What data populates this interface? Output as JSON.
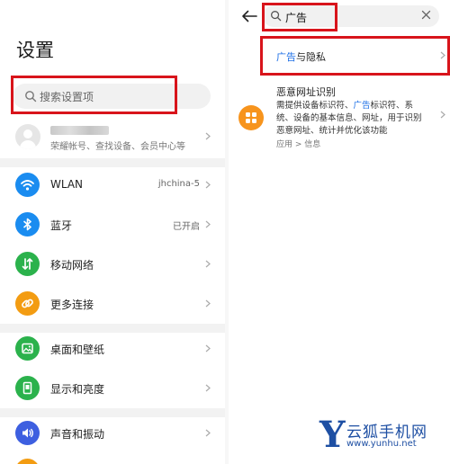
{
  "left": {
    "title": "设置",
    "search": {
      "placeholder": "搜索设置项"
    },
    "account": {
      "subtitle": "荣耀帐号、查找设备、会员中心等"
    },
    "items": [
      {
        "label": "WLAN",
        "value": "jhchina-5",
        "icon": "wifi-icon",
        "color": "#1a8cf0"
      },
      {
        "label": "蓝牙",
        "value": "已开启",
        "icon": "bluetooth-icon",
        "color": "#1a8cf0"
      },
      {
        "label": "移动网络",
        "value": "",
        "icon": "mobile-data-icon",
        "color": "#2bb24c"
      },
      {
        "label": "更多连接",
        "value": "",
        "icon": "link-icon",
        "color": "#f39c12"
      },
      {
        "label": "桌面和壁纸",
        "value": "",
        "icon": "image-icon",
        "color": "#2bb24c"
      },
      {
        "label": "显示和亮度",
        "value": "",
        "icon": "display-icon",
        "color": "#2bb24c"
      },
      {
        "label": "声音和振动",
        "value": "",
        "icon": "sound-icon",
        "color": "#3d5fe0"
      }
    ]
  },
  "right": {
    "search": {
      "query": "广告"
    },
    "result1": {
      "highlight": "广告",
      "rest": "与隐私"
    },
    "result2": {
      "title": "恶意网址识别",
      "desc_before": "需提供设备标识符、",
      "desc_highlight": "广告",
      "desc_after": "标识符、系统、设备的基本信息、网址，用于识别恶意网址、统计并优化该功能",
      "crumb": "应用 > 信息",
      "icon": "apps-grid-icon",
      "color": "#f7941d"
    }
  },
  "watermark": {
    "letter": "Y",
    "name": "云狐手机网",
    "url": "www.yunhu.net"
  },
  "colors": {
    "highlight": "#d8141b",
    "accent": "#1b6ee6"
  }
}
